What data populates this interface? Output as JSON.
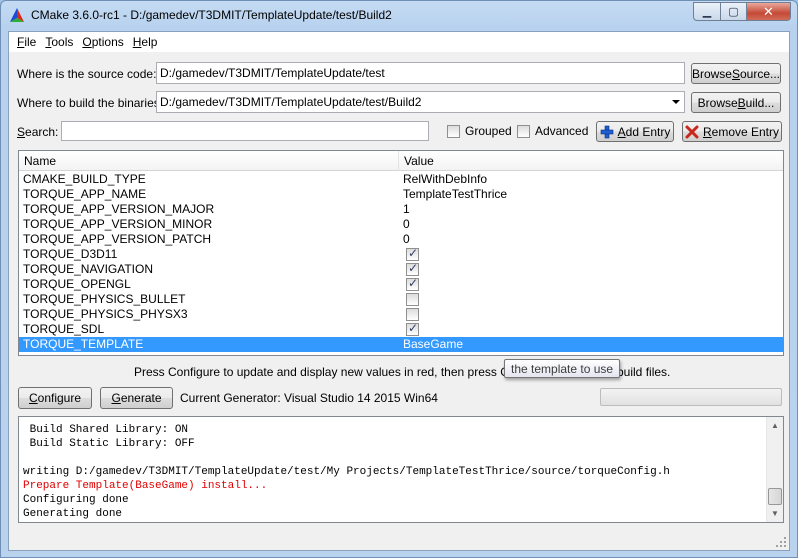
{
  "window": {
    "title": "CMake 3.6.0-rc1 - D:/gamedev/T3DMIT/TemplateUpdate/test/Build2",
    "min_glyph": "▁",
    "max_glyph": "▢",
    "close_glyph": "✕"
  },
  "menu": [
    {
      "acc": "F",
      "rest": "ile"
    },
    {
      "acc": "T",
      "rest": "ools"
    },
    {
      "acc": "O",
      "rest": "ptions"
    },
    {
      "acc": "H",
      "rest": "elp"
    }
  ],
  "source": {
    "label": "Where is the source code:",
    "value": "D:/gamedev/T3DMIT/TemplateUpdate/test",
    "button_pre": "Browse ",
    "button_acc": "S",
    "button_post": "ource..."
  },
  "build": {
    "label": "Where to build the binaries:",
    "value": "D:/gamedev/T3DMIT/TemplateUpdate/test/Build2",
    "button_pre": "Browse ",
    "button_acc": "B",
    "button_post": "uild..."
  },
  "search": {
    "label_acc": "S",
    "label_rest": "earch:",
    "value": ""
  },
  "options": {
    "grouped": "Grouped",
    "advanced": "Advanced",
    "add_pre": "",
    "add_acc": "A",
    "add_post": "dd Entry",
    "remove_pre": "",
    "remove_acc": "R",
    "remove_post": "emove Entry"
  },
  "table": {
    "col_name": "Name",
    "col_value": "Value",
    "rows": [
      {
        "name": "CMAKE_BUILD_TYPE",
        "value": "RelWithDebInfo"
      },
      {
        "name": "TORQUE_APP_NAME",
        "value": "TemplateTestThrice"
      },
      {
        "name": "TORQUE_APP_VERSION_MAJOR",
        "value": "1"
      },
      {
        "name": "TORQUE_APP_VERSION_MINOR",
        "value": "0"
      },
      {
        "name": "TORQUE_APP_VERSION_PATCH",
        "value": "0"
      },
      {
        "name": "TORQUE_D3D11",
        "checked": true
      },
      {
        "name": "TORQUE_NAVIGATION",
        "checked": true
      },
      {
        "name": "TORQUE_OPENGL",
        "checked": true
      },
      {
        "name": "TORQUE_PHYSICS_BULLET",
        "checked": false
      },
      {
        "name": "TORQUE_PHYSICS_PHYSX3",
        "checked": false
      },
      {
        "name": "TORQUE_SDL",
        "checked": true
      },
      {
        "name": "TORQUE_TEMPLATE",
        "value": "BaseGame",
        "selected": true
      }
    ],
    "check_glyph": "✓"
  },
  "hint": {
    "before": "Press Configure to update and display new values in red, then press Genera",
    "after": "build files."
  },
  "tooltip": "the template to use",
  "actions": {
    "configure_acc": "C",
    "configure_rest": "onfigure",
    "generate_acc": "G",
    "generate_rest": "enerate",
    "generator_label": "Current Generator: Visual Studio 14 2015 Win64"
  },
  "progress": 0,
  "output": [
    {
      "text": " Build Shared Library: ON",
      "color": "normal"
    },
    {
      "text": " Build Static Library: OFF",
      "color": "normal"
    },
    {
      "text": "",
      "color": "normal"
    },
    {
      "text": "writing D:/gamedev/T3DMIT/TemplateUpdate/test/My Projects/TemplateTestThrice/source/torqueConfig.h",
      "color": "normal"
    },
    {
      "text": "Prepare Template(BaseGame) install...",
      "color": "red"
    },
    {
      "text": "Configuring done",
      "color": "normal"
    },
    {
      "text": "Generating done",
      "color": "normal"
    }
  ],
  "colors": {
    "selection": "#3399ff",
    "error_text": "#e00000"
  }
}
